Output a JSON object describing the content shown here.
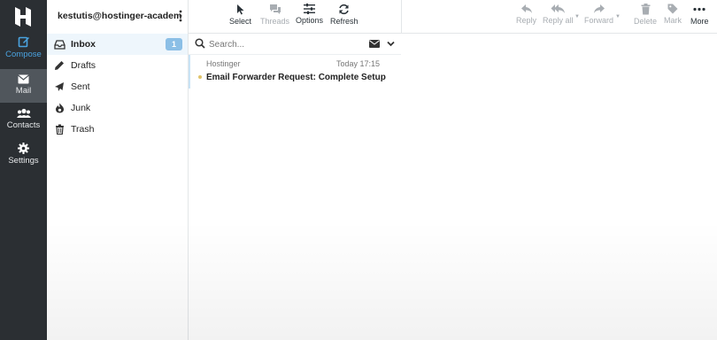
{
  "rail": {
    "compose_label": "Compose",
    "mail_label": "Mail",
    "contacts_label": "Contacts",
    "settings_label": "Settings"
  },
  "account": {
    "email": "kestutis@hostinger-academy..."
  },
  "folders": [
    {
      "label": "Inbox",
      "icon": "inbox-icon",
      "unread": "1"
    },
    {
      "label": "Drafts",
      "icon": "pencil-icon"
    },
    {
      "label": "Sent",
      "icon": "paper-plane-icon"
    },
    {
      "label": "Junk",
      "icon": "fire-icon"
    },
    {
      "label": "Trash",
      "icon": "trash-icon"
    }
  ],
  "toolbar": {
    "select": "Select",
    "threads": "Threads",
    "options": "Options",
    "refresh": "Refresh",
    "reply": "Reply",
    "reply_all": "Reply all",
    "forward": "Forward",
    "delete": "Delete",
    "mark": "Mark",
    "more": "More"
  },
  "search": {
    "placeholder": "Search..."
  },
  "messages": [
    {
      "from": "Hostinger",
      "date": "Today 17:15",
      "subject": "Email Forwarder Request: Complete Setup"
    }
  ],
  "colors": {
    "rail_bg": "#2b2f33",
    "rail_active": "#50565c",
    "accent": "#4aa3e0",
    "badge": "#8bbfe6"
  }
}
